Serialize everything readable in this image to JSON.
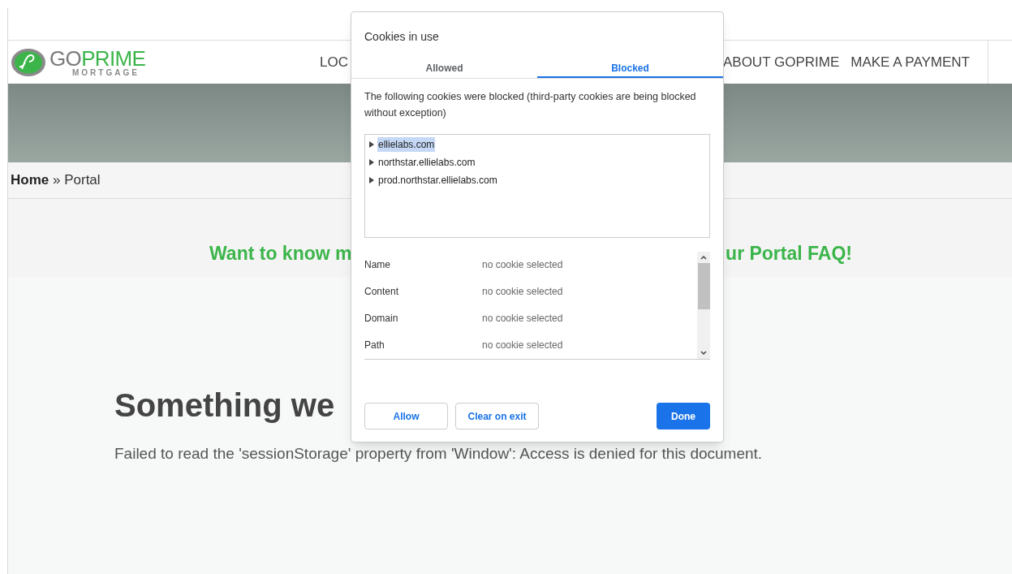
{
  "site": {
    "logo": {
      "go": "GO",
      "prime": "PRIME",
      "sub": "MORTGAGE"
    },
    "nav": [
      "LOC",
      "ABOUT GOPRIME",
      "MAKE A PAYMENT"
    ],
    "breadcrumb": {
      "home": "Home",
      "separator": "»",
      "current": "Portal"
    },
    "banner": {
      "left": "Want to know m",
      "right": "ur Portal FAQ!"
    },
    "error": {
      "title": "Something we",
      "message": "Failed to read the 'sessionStorage' property from 'Window': Access is denied for this document."
    }
  },
  "dialog": {
    "title": "Cookies in use",
    "tabs": [
      {
        "label": "Allowed",
        "selected": false
      },
      {
        "label": "Blocked",
        "selected": true
      }
    ],
    "description": "The following cookies were blocked (third-party cookies are being blocked without exception)",
    "tree": [
      {
        "label": "ellielabs.com",
        "selected": true,
        "expanded": false
      },
      {
        "label": "northstar.ellielabs.com",
        "selected": false,
        "expanded": false
      },
      {
        "label": "prod.northstar.ellielabs.com",
        "selected": false,
        "expanded": false
      }
    ],
    "details": [
      {
        "label": "Name",
        "value": "no cookie selected"
      },
      {
        "label": "Content",
        "value": "no cookie selected"
      },
      {
        "label": "Domain",
        "value": "no cookie selected"
      },
      {
        "label": "Path",
        "value": "no cookie selected"
      }
    ],
    "buttons": [
      {
        "label": "Allow",
        "kind": "secondary"
      },
      {
        "label": "Clear on exit",
        "kind": "secondary"
      },
      {
        "label": "Done",
        "kind": "primary"
      }
    ]
  }
}
